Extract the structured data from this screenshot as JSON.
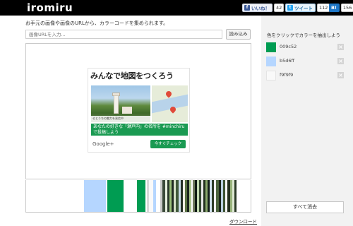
{
  "header": {
    "logo": "iromiru",
    "social": {
      "facebook": {
        "label": "いいね！",
        "count": "42"
      },
      "twitter": {
        "label": "ツイート",
        "count": "112"
      },
      "hatena": {
        "label": "B!",
        "count": "156"
      }
    }
  },
  "main": {
    "instruction": "お手元の画像や画像のURLから、カラーコードを集められます。",
    "url_input": {
      "placeholder": "画像URLを入力..."
    },
    "load_button": "読み込み",
    "download_link": "ダウンロード"
  },
  "ad": {
    "title": "みんなで地図をつくろう",
    "photo_caption": "せとうちの魅力を発信中",
    "message": "あなたの好きな「瀬戸内」の名所を #minchiru で投稿しよう",
    "google": "Google+",
    "cta": "今すぐチェック"
  },
  "stripes": [
    {
      "color": "#ffffff",
      "w": 82
    },
    {
      "color": "#b5d6ff",
      "w": 31
    },
    {
      "color": "#ffffff",
      "w": 2
    },
    {
      "color": "#009c52",
      "w": 23
    },
    {
      "color": "#ffffff",
      "w": 19
    },
    {
      "color": "#009c52",
      "w": 12
    },
    {
      "color": "#ffffff",
      "w": 2
    },
    {
      "color": "#d8d8d8",
      "w": 3
    },
    {
      "color": "#f9f9f9",
      "w": 6
    },
    {
      "color": "#b5d6ff",
      "w": 4
    },
    {
      "color": "#ffffff",
      "w": 6
    },
    {
      "color": "#c8c8c8",
      "w": 3
    },
    {
      "color": "#3b4a3a",
      "w": 4
    },
    {
      "color": "#e8f0e0",
      "w": 3
    },
    {
      "color": "#2b3a2c",
      "w": 3
    },
    {
      "color": "#9bc07a",
      "w": 3
    },
    {
      "color": "#1f2b22",
      "w": 3
    },
    {
      "color": "#d6e2c8",
      "w": 3
    },
    {
      "color": "#415a3b",
      "w": 4
    },
    {
      "color": "#c9dde8",
      "w": 3
    },
    {
      "color": "#263026",
      "w": 3
    },
    {
      "color": "#f2efe5",
      "w": 3
    },
    {
      "color": "#5b7344",
      "w": 3
    },
    {
      "color": "#1b241d",
      "w": 3
    },
    {
      "color": "#a9c48b",
      "w": 3
    },
    {
      "color": "#ffffff",
      "w": 2
    },
    {
      "color": "#6f7b5e",
      "w": 3
    },
    {
      "color": "#0e1a12",
      "w": 3
    },
    {
      "color": "#c1d8b0",
      "w": 3
    },
    {
      "color": "#354a30",
      "w": 3
    },
    {
      "color": "#e8e8e8",
      "w": 3
    },
    {
      "color": "#22311f",
      "w": 3
    },
    {
      "color": "#8aa86c",
      "w": 3
    },
    {
      "color": "#14201a",
      "w": 3
    },
    {
      "color": "#d3e4f1",
      "w": 3
    },
    {
      "color": "#2e3d2a",
      "w": 3
    },
    {
      "color": "#f0f0f0",
      "w": 3
    },
    {
      "color": "#4d6540",
      "w": 4
    },
    {
      "color": "#1a241b",
      "w": 3
    },
    {
      "color": "#b9cfe0",
      "w": 3
    },
    {
      "color": "#3d5334",
      "w": 3
    },
    {
      "color": "#f7f7f7",
      "w": 3
    },
    {
      "color": "#24301f",
      "w": 4
    },
    {
      "color": "#9ab57d",
      "w": 3
    },
    {
      "color": "#dde8d2",
      "w": 3
    },
    {
      "color": "#2a3926",
      "w": 3
    }
  ],
  "sidebar": {
    "hint": "色をクリックでカラーを抽出しよう",
    "colors": [
      {
        "hex": "#009c52",
        "code": "009c52"
      },
      {
        "hex": "#b5d6ff",
        "code": "b5d6ff"
      },
      {
        "hex": "#f9f9f9",
        "code": "f9f9f9"
      }
    ],
    "delete_glyph": "×",
    "clear_all": "すべて消去"
  }
}
